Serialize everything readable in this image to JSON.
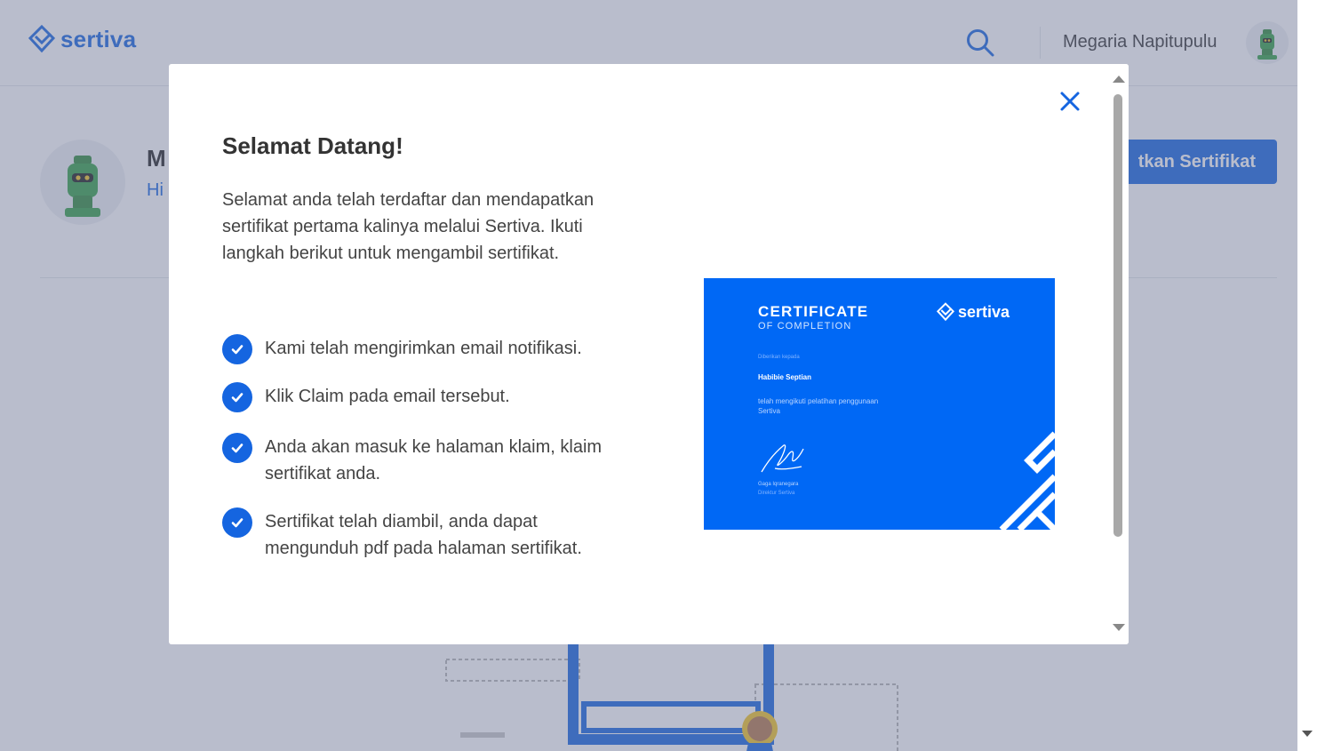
{
  "header": {
    "logo_text": "sertiva",
    "search_icon": "search-icon",
    "user_name": "Megaria Napitupulu",
    "avatar_icon": "robot-avatar-icon"
  },
  "profile": {
    "name_initial": "M",
    "greeting_fragment": "Hi",
    "claim_button_label": "tkan Sertifikat"
  },
  "modal": {
    "title": "Selamat Datang!",
    "intro": "Selamat anda telah terdaftar dan mendapatkan sertifikat pertama kalinya melalui Sertiva. Ikuti langkah berikut untuk mengambil sertifikat.",
    "steps": [
      {
        "text": "Kami telah mengirimkan email notifikasi."
      },
      {
        "text": "Klik Claim pada email tersebut."
      },
      {
        "text": "Anda akan masuk ke halaman klaim, klaim sertifikat anda."
      },
      {
        "text": "Sertifikat telah diambil, anda dapat mengunduh pdf pada halaman sertifikat."
      }
    ],
    "close_icon": "close-icon",
    "step_icon": "check-circle-icon"
  },
  "certificate": {
    "title": "CERTIFICATE",
    "subtitle": "OF COMPLETION",
    "logo_text": "sertiva",
    "given_to": "Diberikan kepada",
    "recipient": "Habibie Septian",
    "description": "telah mengikuti pelatihan penggunaan Sertiva",
    "signer": "Gaga Iqranegara",
    "signer_title": "Direktur Sertiva",
    "background_color": "#0068f5"
  },
  "colors": {
    "brand": "#1565e0",
    "overlay": "rgba(108,118,148,0.48)"
  }
}
